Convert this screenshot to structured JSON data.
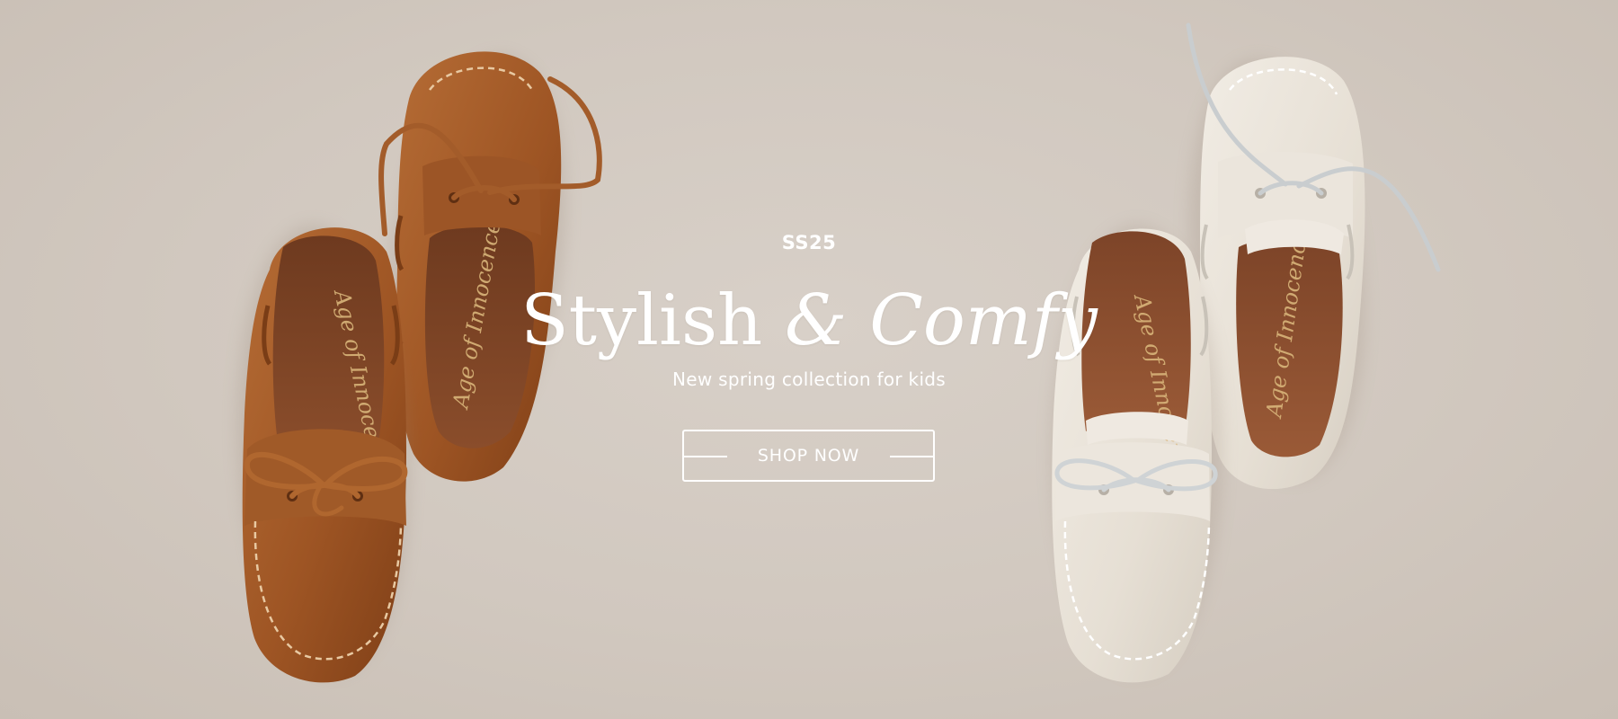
{
  "hero": {
    "eyebrow": "SS25",
    "headline_plain": "Stylish ",
    "headline_amp": "&",
    "headline_italic": " Comfy",
    "subhead": "New spring collection for kids",
    "cta_label": "SHOP NOW",
    "insole_brand": "Age of Innocence"
  },
  "colors": {
    "background": "#d1c8bf",
    "text": "#ffffff",
    "tan_leather": "#a85f2c",
    "cream_leather": "#e9e3d9"
  }
}
